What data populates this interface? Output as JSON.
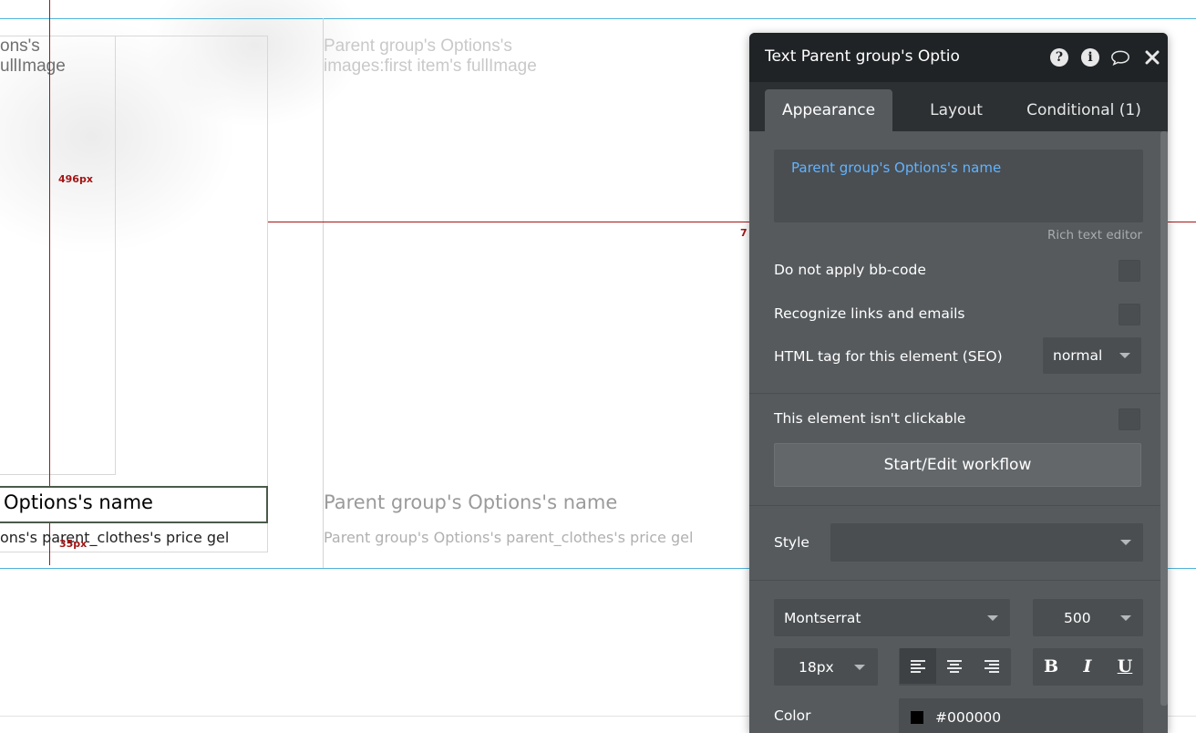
{
  "canvas": {
    "left_text_line1": "ons's",
    "left_text_line2": "ullImage",
    "right_text_line1": "Parent group's Options's",
    "right_text_line2": "images:first item's fullImage",
    "measure_vertical": "496px",
    "measure_horizontal_partial": "7",
    "measure_bottom": "35px",
    "left_name": "Options's name",
    "left_price": "ons's parent_clothes's price gel",
    "right_name": "Parent group's Options's name",
    "right_price": "Parent group's Options's parent_clothes's price gel"
  },
  "editor": {
    "title": "Text Parent group's Optio",
    "icons": [
      "help-icon",
      "info-icon",
      "comment-icon",
      "close-icon"
    ],
    "help_glyph": "?",
    "info_glyph": "i",
    "tabs": [
      {
        "label": "Appearance",
        "active": true
      },
      {
        "label": "Layout",
        "active": false
      },
      {
        "label": "Conditional (1)",
        "active": false
      }
    ],
    "text_value": "Parent group's Options's name",
    "rich_text_editor_label": "Rich text editor",
    "do_not_apply_bbcode_label": "Do not apply bb-code",
    "recognize_links_label": "Recognize links and emails",
    "html_tag_label": "HTML tag for this element (SEO)",
    "html_tag_value": "normal",
    "not_clickable_label": "This element isn't clickable",
    "workflow_button_label": "Start/Edit workflow",
    "style_label": "Style",
    "style_value": "",
    "font_family": "Montserrat",
    "font_weight": "500",
    "font_size": "18px",
    "bold_label": "B",
    "italic_label": "I",
    "underline_label": "U",
    "color_label": "Color",
    "color_value": "#000000",
    "colors": {
      "header_bg": "#1f2326",
      "panel_bg": "#565a5d",
      "tab_bar_bg": "#2c3033",
      "control_bg": "#4a4e51",
      "link_blue": "#62b3ff",
      "measure_red": "#a31515",
      "guide_blue": "#4fb3d9"
    }
  }
}
